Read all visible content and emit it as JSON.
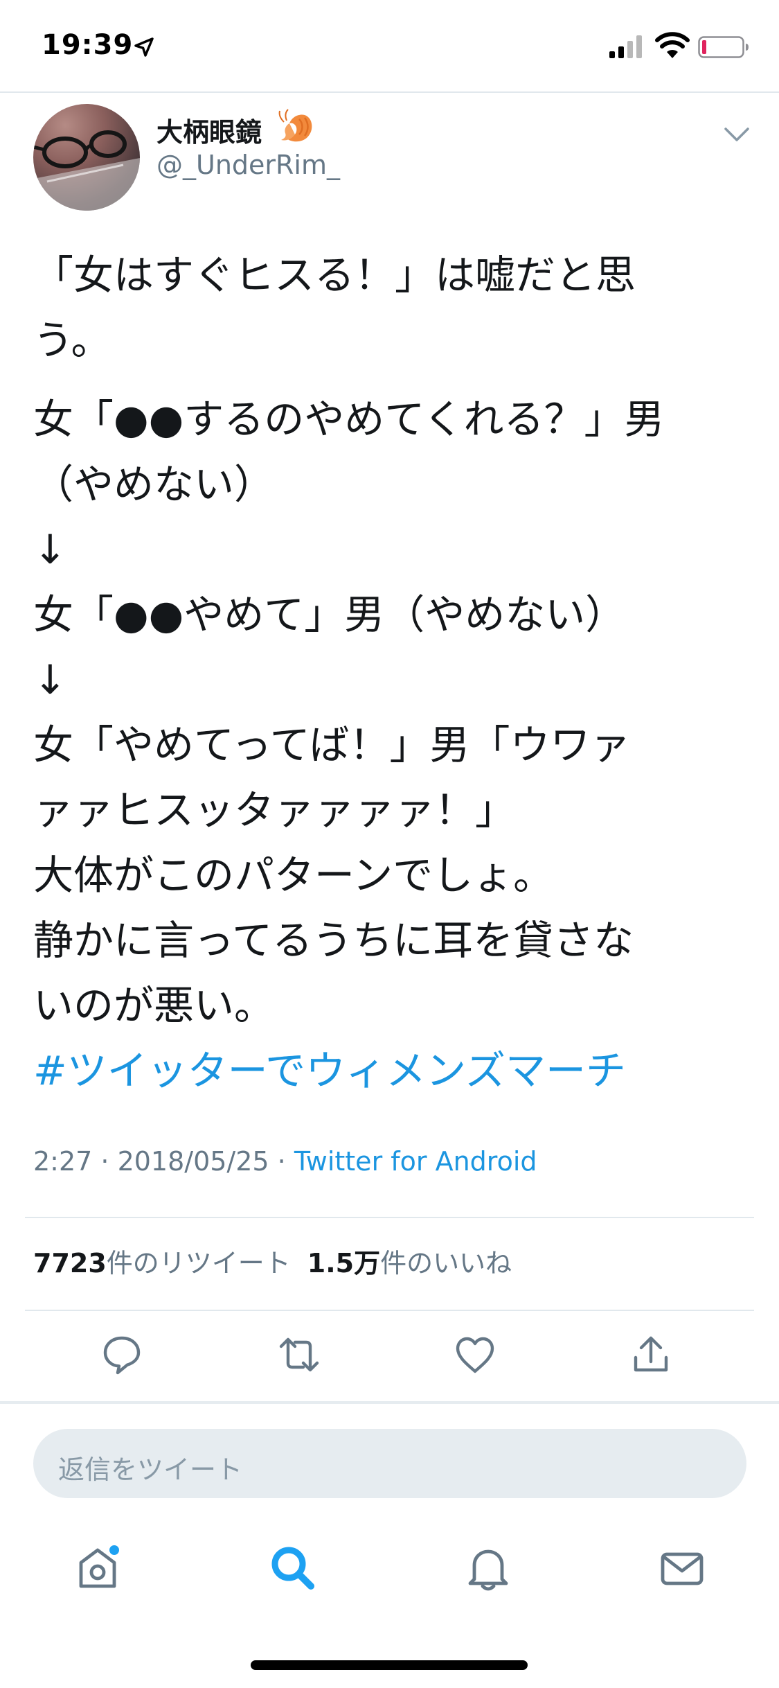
{
  "status_bar": {
    "time": "19:39",
    "icons": [
      "location-arrow-icon",
      "cellular-signal-icon",
      "wifi-icon",
      "battery-low-icon"
    ]
  },
  "tweet": {
    "author": {
      "display_name": "大柄眼鏡",
      "name_emoji": "shrimp-icon",
      "screen_name": "@_UnderRim_"
    },
    "text_lines": [
      "「女はすぐヒスる！」は嘘だと思",
      "う。",
      "女「●●するのやめてくれる？」男",
      "（やめない）",
      "↓",
      "女「●●やめて」男（やめない）",
      "↓",
      "女「やめてってば！」男「ウワァ",
      "ァァヒスッタァァァァ！」",
      "大体がこのパターンでしょ。",
      "静かに言ってるうちに耳を貸さな",
      "いのが悪い。"
    ],
    "hashtag": "#ツイッターでウィメンズマーチ",
    "timestamp": "2:27 · 2018/05/25 · ",
    "source": "Twitter for Android",
    "stats": {
      "retweet_count": "7723",
      "retweet_label": "件のリツイート",
      "like_count": "1.5万",
      "like_label": "件のいいね"
    },
    "actions": [
      "reply-icon",
      "retweet-icon",
      "like-icon",
      "share-icon"
    ]
  },
  "reply_box": {
    "placeholder": "返信をツイート"
  },
  "tab_bar": {
    "tabs": [
      "home-icon",
      "search-icon",
      "notifications-icon",
      "messages-icon"
    ],
    "active": "search",
    "home_has_new": true
  },
  "colors": {
    "link": "#1b95e0",
    "secondary_text": "#657786",
    "divider": "#e1e8ed",
    "reply_box_bg": "#e6ecf0",
    "active_tab": "#1da1f2",
    "inactive_tab": "#657786",
    "battery_low": "#e0245e"
  }
}
